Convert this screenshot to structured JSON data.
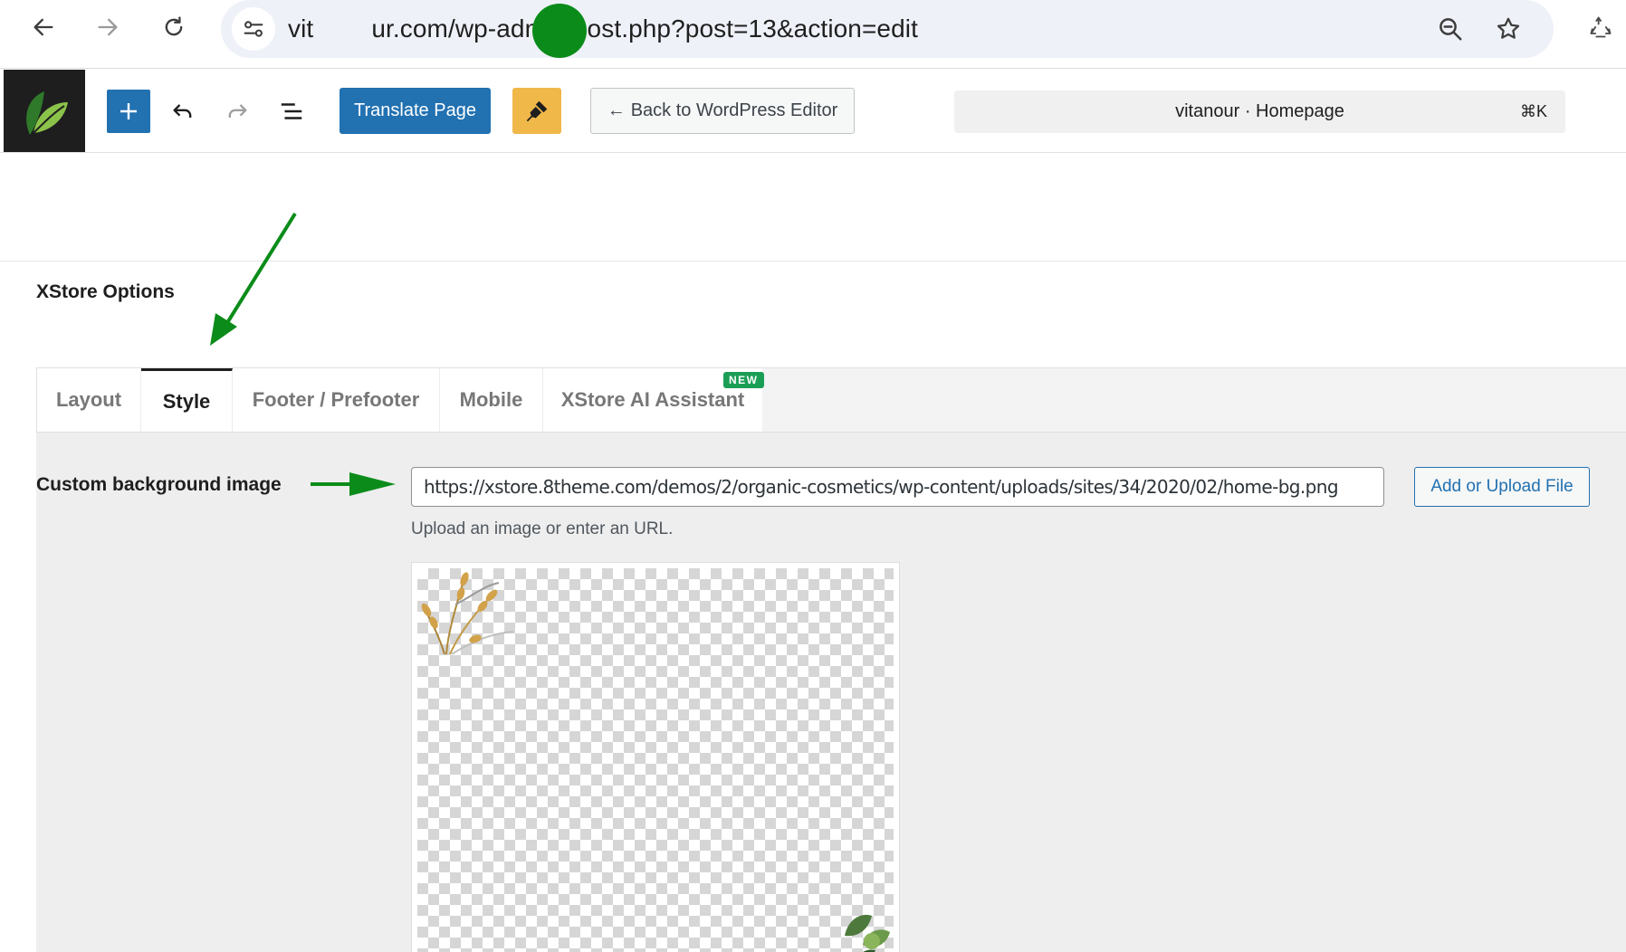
{
  "browser": {
    "url_prefix": "vit",
    "url_suffix": "ur.com/wp-admin/post.php?post=13&action=edit"
  },
  "toolbar": {
    "translate_label": "Translate Page",
    "back_label": "Back to WordPress Editor",
    "command_title": "vitanour · Homepage",
    "command_shortcut": "⌘K"
  },
  "meta_box": {
    "title": "XStore Options",
    "tabs": [
      {
        "label": "Layout",
        "active": false
      },
      {
        "label": "Style",
        "active": true
      },
      {
        "label": "Footer / Prefooter",
        "active": false
      },
      {
        "label": "Mobile",
        "active": false
      },
      {
        "label": "XStore AI Assistant",
        "active": false
      }
    ],
    "new_badge": "NEW"
  },
  "style_tab": {
    "field_label": "Custom background image",
    "field_value": "https://xstore.8theme.com/demos/2/organic-cosmetics/wp-content/uploads/sites/34/2020/02/home-bg.png",
    "upload_label": "Add or Upload File",
    "hint": "Upload an image or enter an URL."
  },
  "colors": {
    "wp_blue": "#2271b1",
    "brush_yellow": "#f0b849",
    "annotation_green": "#0b8c1a",
    "badge_green": "#1a9e55"
  }
}
